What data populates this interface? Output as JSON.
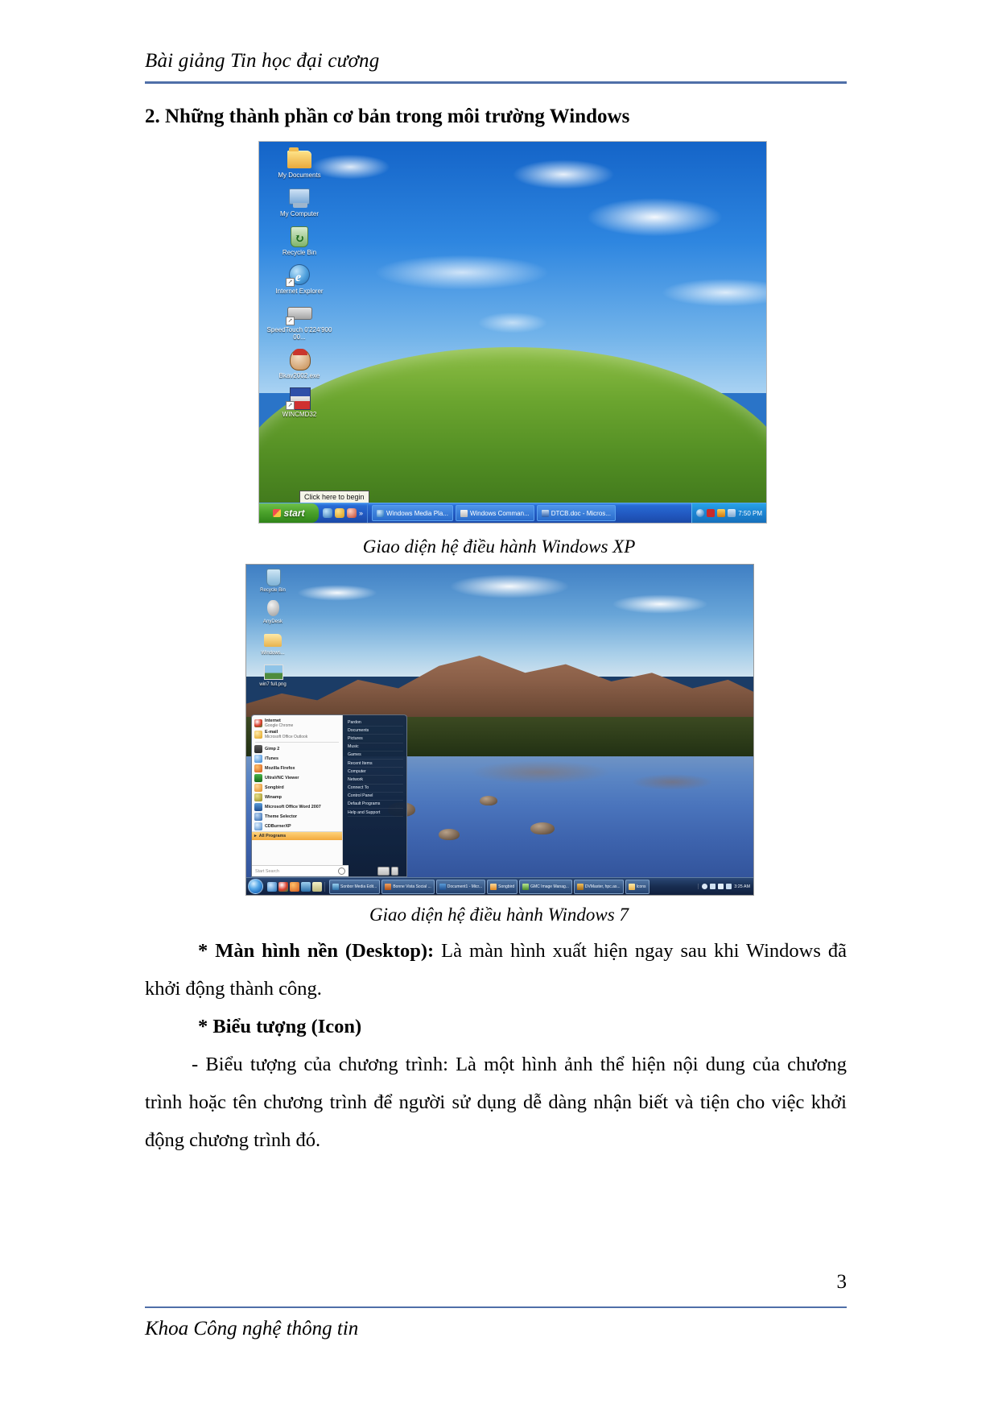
{
  "document": {
    "running_head": "Bài giảng Tin học đại cương",
    "section_heading": "2. Những thành phần cơ bản trong môi trường Windows",
    "page_number": "3",
    "footer": "Khoa Công nghệ thông tin",
    "rule_color": "#4f6fa8"
  },
  "figures": [
    {
      "caption": "Giao diện hệ điều hành Windows XP",
      "os": "Windows XP",
      "desktop_icons": [
        {
          "label": "My Documents",
          "icon": "folder-icon"
        },
        {
          "label": "My Computer",
          "icon": "computer-icon"
        },
        {
          "label": "Recycle Bin",
          "icon": "recycle-bin-icon"
        },
        {
          "label": "Internet Explorer",
          "icon": "internet-explorer-icon"
        },
        {
          "label": "SpeedTouch 0'224'90000...",
          "icon": "modem-icon"
        },
        {
          "label": "Bkav2002.exe",
          "icon": "bkav-icon"
        },
        {
          "label": "WINCMD32",
          "icon": "wincmd-icon"
        }
      ],
      "tooltip": "Click here to begin",
      "taskbar": {
        "start_label": "start",
        "quick_launch": [
          "internet-explorer-icon",
          "media-icon",
          "shield-icon",
          "chevron-right-icon"
        ],
        "tasks": [
          {
            "label": "Windows Media Pla...",
            "icon": "media-player-icon"
          },
          {
            "label": "Windows Comman...",
            "icon": "window-icon"
          },
          {
            "label": "DTCB.doc - Micros...",
            "icon": "word-icon"
          }
        ],
        "tray": {
          "icons": [
            "back-arrow-icon",
            "vietkey-icon",
            "network-icon",
            "volume-icon"
          ],
          "clock": "7:50 PM"
        }
      }
    },
    {
      "caption": "Giao diện hệ điều hành Windows 7",
      "os": "Windows 7",
      "desktop_icons": [
        {
          "label": "Recycle Bin",
          "icon": "recycle-bin-icon"
        },
        {
          "label": "AnyDesk",
          "icon": "app-icon"
        },
        {
          "label": "Windows...",
          "icon": "folder-icon"
        },
        {
          "label": "win7 full.png",
          "icon": "image-icon"
        }
      ],
      "start_menu": {
        "programs": [
          {
            "title": "Internet",
            "subtitle": "Google Chrome",
            "icon": "chrome-icon"
          },
          {
            "title": "E-mail",
            "subtitle": "Microsoft Office Outlook",
            "icon": "outlook-icon"
          },
          {
            "title": "Gimp 2",
            "subtitle": "",
            "icon": "gimp-icon"
          },
          {
            "title": "iTunes",
            "subtitle": "",
            "icon": "itunes-icon"
          },
          {
            "title": "Mozilla Firefox",
            "subtitle": "",
            "icon": "firefox-icon"
          },
          {
            "title": "UltraVNC Viewer",
            "subtitle": "",
            "icon": "vnc-icon"
          },
          {
            "title": "Songbird",
            "subtitle": "",
            "icon": "songbird-icon"
          },
          {
            "title": "Winamp",
            "subtitle": "",
            "icon": "winamp-icon"
          },
          {
            "title": "Microsoft Office Word 2007",
            "subtitle": "",
            "icon": "word-icon"
          },
          {
            "title": "Theme Selector",
            "subtitle": "",
            "icon": "theme-icon"
          },
          {
            "title": "CDBurnerXP",
            "subtitle": "",
            "icon": "cdburner-icon"
          }
        ],
        "all_programs_label": "All Programs",
        "search_placeholder": "Start Search",
        "right_items": [
          "Pardon",
          "Documents",
          "Pictures",
          "Music",
          "Games",
          "Recent Items",
          "Computer",
          "Network",
          "Connect To",
          "Control Panel",
          "Default Programs",
          "Help and Support"
        ]
      },
      "taskbar": {
        "quick_launch": [
          "ie-icon",
          "chrome-icon",
          "firefox-icon",
          "media-icon",
          "notepad-icon"
        ],
        "tasks": [
          {
            "label": "Sonbor Media Edit...",
            "icon": "editor-icon"
          },
          {
            "label": "Bonne Vista Social ...",
            "icon": "browser-icon"
          },
          {
            "label": "Document1 - Micr...",
            "icon": "word-icon"
          },
          {
            "label": "Songbird",
            "icon": "songbird-icon"
          },
          {
            "label": "GMC Image Manag...",
            "icon": "image-icon"
          },
          {
            "label": "DVMaster, hpc.as...",
            "icon": "app-icon"
          },
          {
            "label": "Icons",
            "icon": "folder-icon"
          }
        ],
        "tray": {
          "icons": [
            "action-center-icon",
            "network-icon",
            "volume-icon",
            "language-icon"
          ],
          "clock": "3:25 AM"
        }
      }
    }
  ],
  "body": {
    "p1_lead": "* Màn hình nền (Desktop):",
    "p1_rest": " Là màn hình xuất hiện ngay sau khi Windows đã khởi động thành công.",
    "p2_lead": "* Biểu tượng (Icon)",
    "p3": "- Biểu tượng của chương trình: Là một hình ảnh thể hiện nội dung của chương trình hoặc tên chương trình để người sử dụng dễ dàng nhận biết và tiện cho việc khởi động chương trình đó."
  }
}
